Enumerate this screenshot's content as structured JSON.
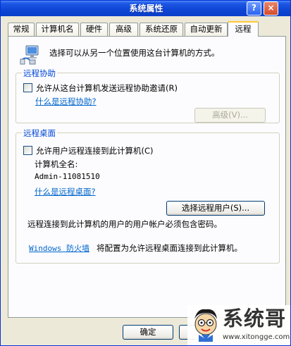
{
  "window": {
    "title": "系统属性",
    "help_label": "?",
    "close_label": "×"
  },
  "tabs": [
    {
      "label": "常规"
    },
    {
      "label": "计算机名"
    },
    {
      "label": "硬件"
    },
    {
      "label": "高级"
    },
    {
      "label": "系统还原"
    },
    {
      "label": "自动更新"
    },
    {
      "label": "远程",
      "active": true
    }
  ],
  "intro": {
    "text": "选择可以从另一个位置使用这台计算机的方式。",
    "icon": "computer-network-icon"
  },
  "remote_assistance": {
    "group_title": "远程协助",
    "checkbox_label": "允许从这台计算机发送远程协助邀请(R)",
    "checked": false,
    "help_link": "什么是远程协助?",
    "advanced_button": "高级(V)..."
  },
  "remote_desktop": {
    "group_title": "远程桌面",
    "checkbox_label": "允许用户远程连接到此计算机(C)",
    "checked": false,
    "computer_name_label": "计算机全名:",
    "computer_name_value": "Admin-11081510",
    "help_link": "什么是远程桌面?",
    "select_users_button": "选择远程用户(S)...",
    "password_note": "远程连接到此计算机的用户的用户帐户必须包含密码。",
    "firewall_link": "Windows 防火墙",
    "firewall_suffix": "将配置为允许远程桌面连接到此计算机。"
  },
  "footer": {
    "ok_button": "确定"
  },
  "watermark": {
    "text": "系统哥",
    "url": "www.xitongge.com"
  },
  "colors": {
    "titlebar": "#0a3fc8",
    "group_title": "#0046d5",
    "link": "#0066cc",
    "active_tab_highlight": "#ffc83c"
  }
}
